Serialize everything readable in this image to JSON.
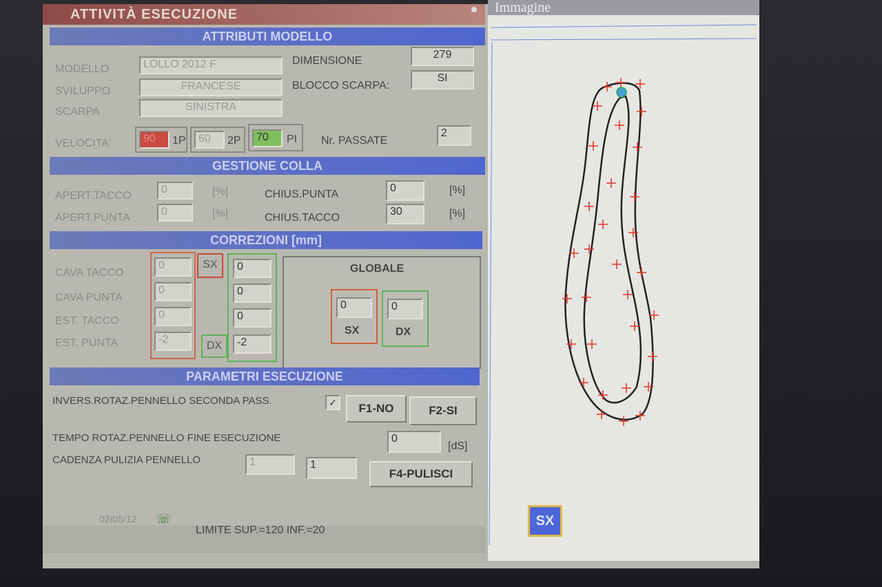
{
  "title": "ATTIVITÀ ESECUZIONE",
  "sections": {
    "attributi": "ATTRIBUTI MODELLO",
    "colla": "GESTIONE COLLA",
    "correzioni": "CORREZIONI [mm]",
    "parametri": "PARAMETRI ESECUZIONE"
  },
  "model": {
    "modello_label": "MODELLO",
    "modello_value": "LOLLO 2012 F",
    "sviluppo_label": "SVILUPPO",
    "sviluppo_value": "FRANCESE",
    "scarpa_label": "SCARPA",
    "scarpa_value": "SINISTRA",
    "dimensione_label": "DIMENSIONE",
    "dimensione_value": "279",
    "blocco_label": "BLOCCO SCARPA:",
    "blocco_value": "SI",
    "velocita_label": "VELOCITA'",
    "v1": "90",
    "v1_unit": "1P",
    "v2": "60",
    "v2_unit": "2P",
    "v3": "70",
    "v3_unit": "PI",
    "passate_label": "Nr. PASSATE",
    "passate_value": "2"
  },
  "colla": {
    "apert_tacco_label": "APERT.TACCO",
    "apert_tacco_value": "0",
    "apert_tacco_unit": "[%]",
    "apert_punta_label": "APERT.PUNTA",
    "apert_punta_value": "0",
    "apert_punta_unit": "[%]",
    "chius_punta_label": "CHIUS.PUNTA",
    "chius_punta_value": "0",
    "chius_punta_unit": "[%]",
    "chius_tacco_label": "CHIUS.TACCO",
    "chius_tacco_value": "30",
    "chius_tacco_unit": "[%]"
  },
  "correzioni": {
    "rows": [
      {
        "label": "CAVA TACCO",
        "sx": "0",
        "dx": "0"
      },
      {
        "label": "CAVA PUNTA",
        "sx": "0",
        "dx": "0"
      },
      {
        "label": "EST. TACCO",
        "sx": "0",
        "dx": "0"
      },
      {
        "label": "EST. PUNTA",
        "sx": "-2",
        "dx": "-2"
      }
    ],
    "sx_label": "SX",
    "dx_label": "DX",
    "globale_label": "GLOBALE",
    "globale_sx_value": "0",
    "globale_sx_label": "SX",
    "globale_dx_value": "0",
    "globale_dx_label": "DX"
  },
  "parametri": {
    "invers_label": "INVERS.ROTAZ.PENNELLO SECONDA PASS.",
    "invers_checked": "✓",
    "f1_label": "F1-NO",
    "f2_label": "F2-SI",
    "tempo_label": "TEMPO ROTAZ.PENNELLO FINE ESECUZIONE",
    "tempo_value": "0",
    "tempo_unit": "[dS]",
    "cadenza_label": "CADENZA PULIZIA PENNELLO",
    "cadenza_value1": "1",
    "cadenza_value2": "1",
    "f4_label": "F4-PULISCI"
  },
  "status": {
    "date": "02/05/12",
    "limits": "LIMITE SUP.=120  INF.=20"
  },
  "image_panel": {
    "title": "Immagine",
    "side_button": "SX"
  },
  "colors": {
    "section_blue": "#4f66d0",
    "title_red": "#8e4a48",
    "sx_border": "#d0603a",
    "dx_border": "#5cb35a",
    "marker_red": "#e0332a",
    "contour": "#222222"
  }
}
